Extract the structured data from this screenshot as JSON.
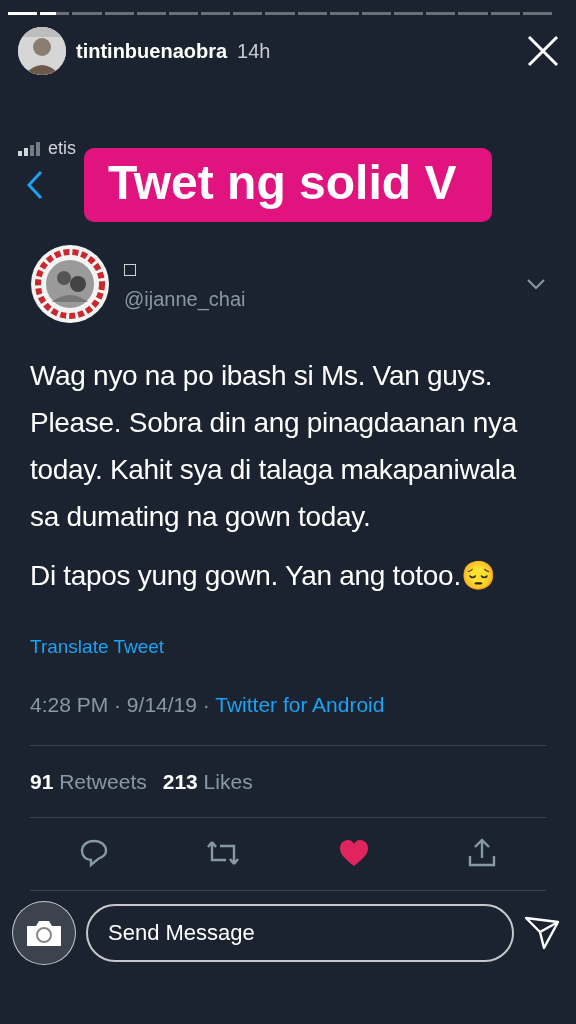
{
  "story": {
    "segments": [
      {
        "level": 1
      },
      {
        "level": 0.55
      },
      {
        "level": 0
      },
      {
        "level": 0
      },
      {
        "level": 0
      },
      {
        "level": 0
      },
      {
        "level": 0
      },
      {
        "level": 0
      },
      {
        "level": 0
      },
      {
        "level": 0
      },
      {
        "level": 0
      },
      {
        "level": 0
      },
      {
        "level": 0
      },
      {
        "level": 0
      },
      {
        "level": 0
      },
      {
        "level": 0
      },
      {
        "level": 0
      }
    ],
    "username": "tintinbuenaobra",
    "time": "14h"
  },
  "status_bar": {
    "carrier": "etis"
  },
  "sticker": {
    "text": "Twet ng solid V"
  },
  "tweet": {
    "name": "□",
    "handle": "@ijanne_chai",
    "paragraphs": [
      "Wag nyo na po ibash si Ms. Van guys. Please. Sobra din ang pinagdaanan nya today. Kahit sya di talaga makapaniwala sa dumating na gown today.",
      "Di tapos yung gown. Yan ang totoo.😔"
    ],
    "translate": "Translate Tweet",
    "meta": "4:28 PM · 9/14/19 · ",
    "source": "Twitter for Android",
    "stats": [
      {
        "count": "91",
        "label": "Retweets"
      },
      {
        "count": "213",
        "label": "Likes"
      }
    ],
    "liked": true
  },
  "reply_bar": {
    "placeholder": "Send Message"
  }
}
